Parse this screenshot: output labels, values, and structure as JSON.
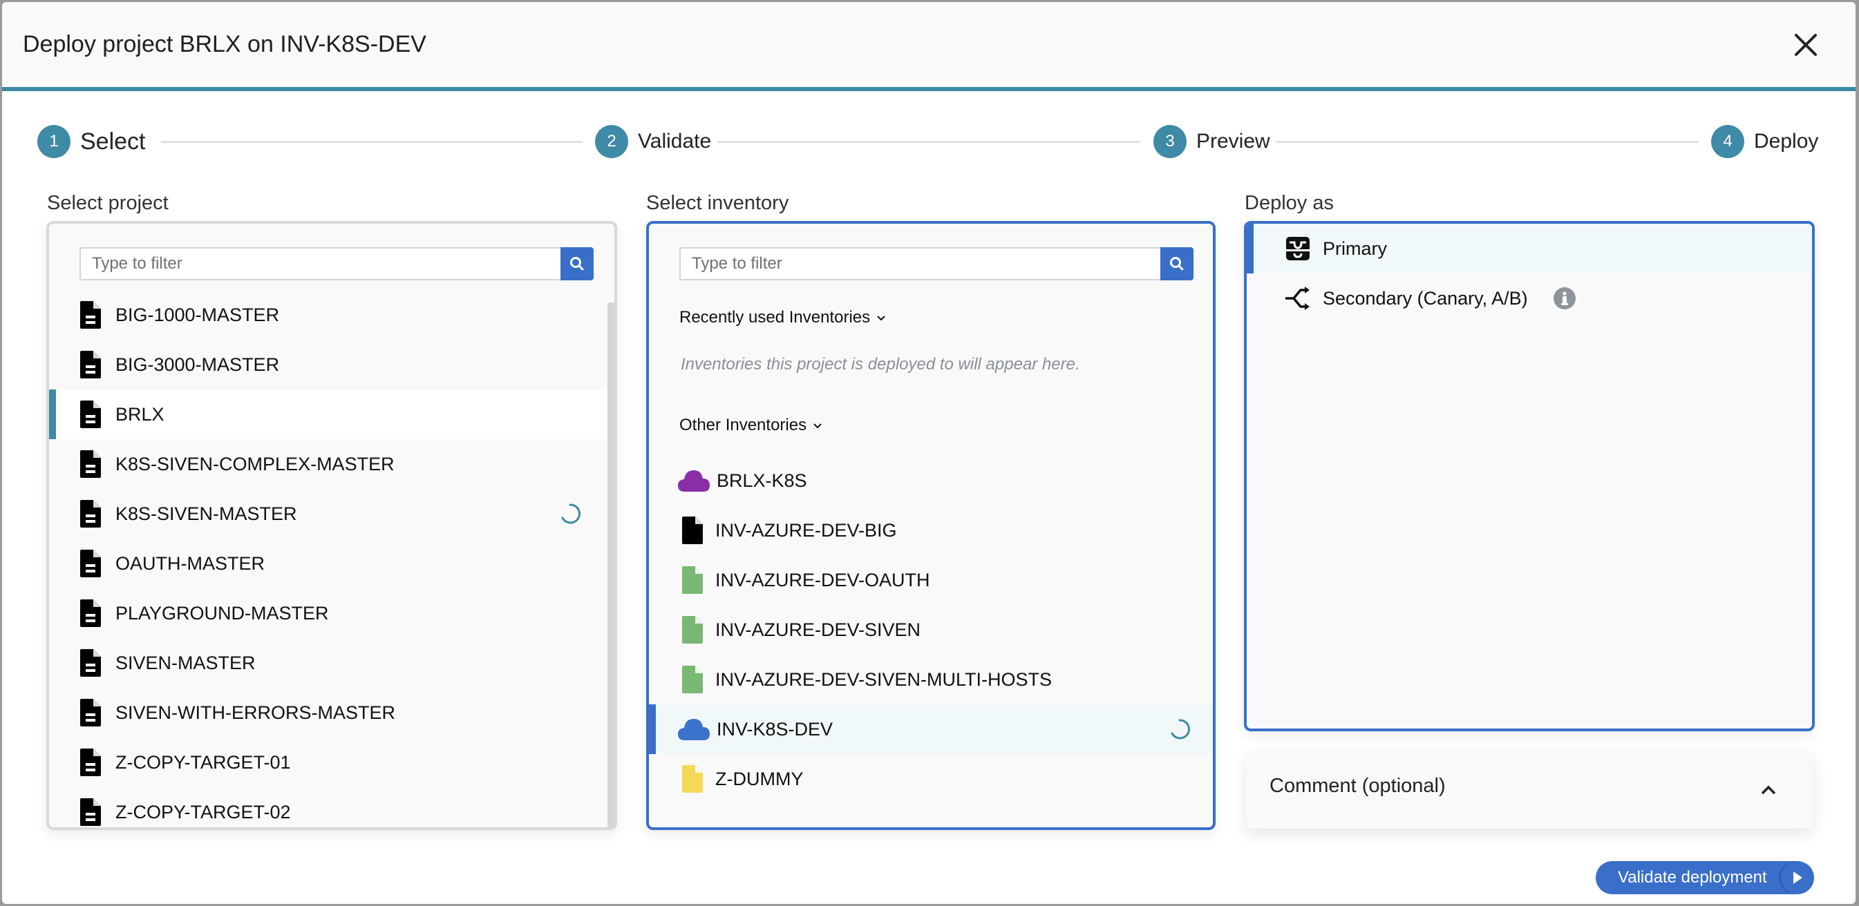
{
  "dialog": {
    "title": "Deploy project BRLX on INV-K8S-DEV",
    "close_icon": "close-icon"
  },
  "stepper": {
    "steps": [
      {
        "number": "1",
        "label": "Select",
        "active": true
      },
      {
        "number": "2",
        "label": "Validate",
        "active": false
      },
      {
        "number": "3",
        "label": "Preview",
        "active": false
      },
      {
        "number": "4",
        "label": "Deploy",
        "active": false
      }
    ]
  },
  "project_panel": {
    "label": "Select project",
    "filter_placeholder": "Type to filter",
    "filter_value": "",
    "items": [
      {
        "name": "BIG-1000-MASTER",
        "icon": "file-icon"
      },
      {
        "name": "BIG-3000-MASTER",
        "icon": "file-icon"
      },
      {
        "name": "BRLX",
        "icon": "file-icon",
        "selected": true
      },
      {
        "name": "K8S-SIVEN-COMPLEX-MASTER",
        "icon": "file-icon"
      },
      {
        "name": "K8S-SIVEN-MASTER",
        "icon": "file-icon",
        "loading": true
      },
      {
        "name": "OAUTH-MASTER",
        "icon": "file-icon"
      },
      {
        "name": "PLAYGROUND-MASTER",
        "icon": "file-icon"
      },
      {
        "name": "SIVEN-MASTER",
        "icon": "file-icon"
      },
      {
        "name": "SIVEN-WITH-ERRORS-MASTER",
        "icon": "file-icon"
      },
      {
        "name": "Z-COPY-TARGET-01",
        "icon": "file-icon"
      },
      {
        "name": "Z-COPY-TARGET-02",
        "icon": "file-icon"
      }
    ]
  },
  "inventory_panel": {
    "label": "Select inventory",
    "filter_placeholder": "Type to filter",
    "filter_value": "",
    "recent_header": "Recently used Inventories",
    "recent_empty": "Inventories this project is deployed to will appear here.",
    "other_header": "Other Inventories",
    "items": [
      {
        "name": "BRLX-K8S",
        "icon": "cloud-icon",
        "color": "#8a2ea8"
      },
      {
        "name": "INV-AZURE-DEV-BIG",
        "icon": "file-icon",
        "color": "#000000"
      },
      {
        "name": "INV-AZURE-DEV-OAUTH",
        "icon": "file-icon",
        "color": "#79b872"
      },
      {
        "name": "INV-AZURE-DEV-SIVEN",
        "icon": "file-icon",
        "color": "#79b872"
      },
      {
        "name": "INV-AZURE-DEV-SIVEN-MULTI-HOSTS",
        "icon": "file-icon",
        "color": "#79b872"
      },
      {
        "name": "INV-K8S-DEV",
        "icon": "cloud-icon",
        "color": "#3a72cc",
        "selected": true,
        "loading": true
      },
      {
        "name": "Z-DUMMY",
        "icon": "file-icon",
        "color": "#f5d85a"
      }
    ]
  },
  "deploy_panel": {
    "label": "Deploy as",
    "options": [
      {
        "label": "Primary",
        "icon": "inbox-icon",
        "selected": true
      },
      {
        "label": "Secondary (Canary, A/B)",
        "icon": "split-icon",
        "info": true
      }
    ]
  },
  "comment": {
    "label": "Comment (optional)"
  },
  "actions": {
    "validate_label": "Validate deployment"
  },
  "colors": {
    "accent_teal": "#3f8aa6",
    "accent_blue": "#3a6fc9"
  }
}
